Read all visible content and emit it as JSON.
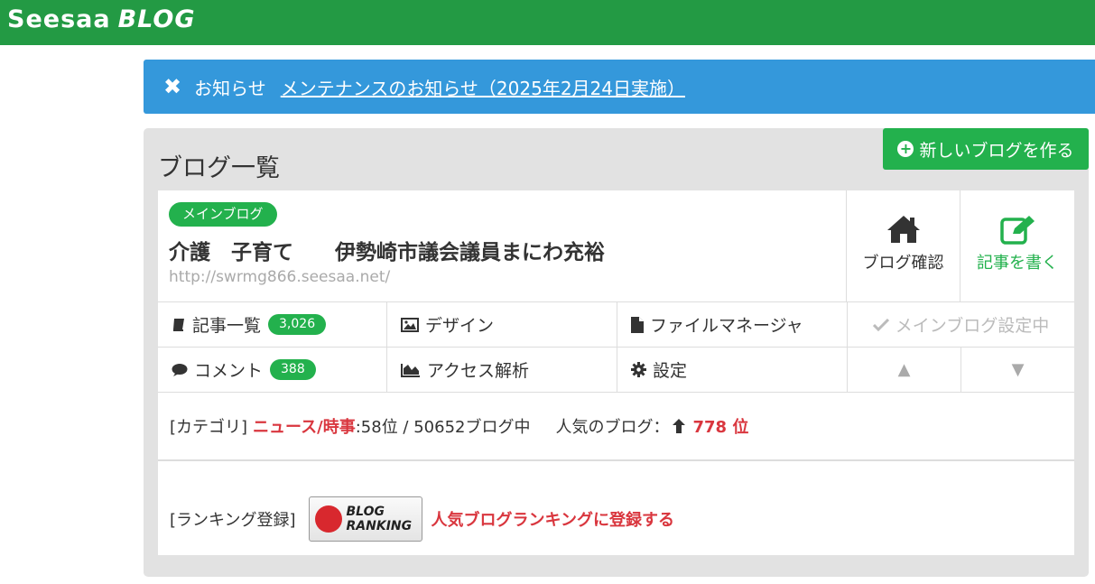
{
  "header": {
    "logo_text": "Seesaa",
    "logo_blog": "BLOG",
    "bg_color": "#239a44"
  },
  "notice": {
    "label": "お知らせ",
    "link_text": "メンテナンスのお知らせ（2025年2月24日実施）",
    "bg_color": "#3498db"
  },
  "panel": {
    "title": "ブログ一覧",
    "new_blog_button": "新しいブログを作る"
  },
  "blog": {
    "badge": "メインブログ",
    "title": "介護　子育て　　伊勢崎市議会議員まにわ充裕",
    "url": "http://swrmg866.seesaa.net/",
    "confirm_label": "ブログ確認",
    "write_label": "記事を書く"
  },
  "menu": {
    "articles_label": "記事一覧",
    "articles_count": "3,026",
    "design_label": "デザイン",
    "file_manager_label": "ファイルマネージャ",
    "main_blog_status": "メインブログ設定中",
    "comments_label": "コメント",
    "comments_count": "388",
    "access_label": "アクセス解析",
    "settings_label": "設定",
    "move_up": "▲",
    "move_down": "▼"
  },
  "category": {
    "prefix": "[カテゴリ]",
    "name": "ニュース/時事",
    "rank_text": ":58位 / 50652ブログ中",
    "popular_label": "人気のブログ：",
    "popular_rank": "778 位"
  },
  "ranking": {
    "prefix": "[ランキング登録]",
    "banner_line1": "BLOG",
    "banner_line2": "RANKING",
    "link_text": "人気ブログランキングに登録する"
  }
}
